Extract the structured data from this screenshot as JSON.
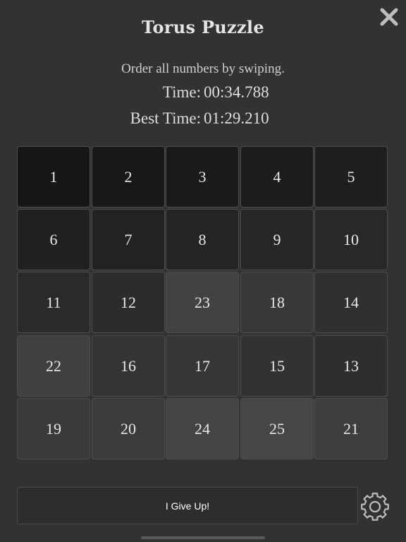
{
  "header": {
    "title": "Torus Puzzle",
    "close_icon": "close-icon"
  },
  "instructions": "Order all numbers by swiping.",
  "stats": {
    "time_label": "Time:",
    "time_value": "00:34.788",
    "best_label": "Best Time:",
    "best_value": "01:29.210"
  },
  "board": {
    "columns": 5,
    "rows": 5,
    "tiles": [
      "1",
      "2",
      "3",
      "4",
      "5",
      "6",
      "7",
      "8",
      "9",
      "10",
      "11",
      "12",
      "23",
      "18",
      "14",
      "22",
      "16",
      "17",
      "15",
      "13",
      "19",
      "20",
      "24",
      "25",
      "21"
    ],
    "tile_colors": {
      "1": "#161616",
      "2": "#181818",
      "3": "#1a1a1a",
      "4": "#1c1c1c",
      "5": "#1e1e1e",
      "6": "#202020",
      "7": "#222222",
      "8": "#242424",
      "9": "#262626",
      "10": "#282828",
      "11": "#2a2a2a",
      "12": "#2c2c2c",
      "13": "#2e2e2e",
      "14": "#303030",
      "15": "#323232",
      "16": "#343434",
      "17": "#363636",
      "18": "#383838",
      "19": "#3a3a3a",
      "20": "#3c3c3c",
      "21": "#3e3e3e",
      "22": "#404040",
      "23": "#424242",
      "24": "#444444",
      "25": "#464646"
    }
  },
  "footer": {
    "give_up_label": "I Give Up!",
    "settings_icon": "gear-icon"
  }
}
